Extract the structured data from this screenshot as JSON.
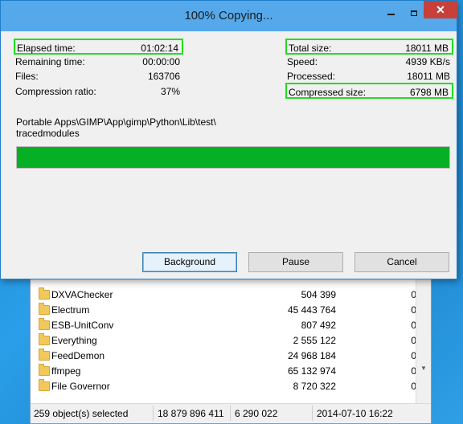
{
  "file_manager": {
    "rows": [
      {
        "name": "",
        "size": "",
        "extra": ""
      },
      {
        "name": "DXVAChecker",
        "size": "504 399",
        "extra": "0"
      },
      {
        "name": "Electrum",
        "size": "45 443 764",
        "extra": "0"
      },
      {
        "name": "ESB-UnitConv",
        "size": "807 492",
        "extra": "0"
      },
      {
        "name": "Everything",
        "size": "2 555 122",
        "extra": "0"
      },
      {
        "name": "FeedDemon",
        "size": "24 968 184",
        "extra": "0"
      },
      {
        "name": "ffmpeg",
        "size": "65 132 974",
        "extra": "0"
      },
      {
        "name": "File Governor",
        "size": "8 720 322",
        "extra": "0"
      }
    ],
    "status": {
      "selected": "259 object(s) selected",
      "total": "18 879 896 411",
      "packed": "6 290 022",
      "date": "2014-07-10 16:22"
    }
  },
  "dialog": {
    "title": "100% Copying...",
    "left_stats": [
      {
        "label": "Elapsed time:",
        "value": "01:02:14"
      },
      {
        "label": "Remaining time:",
        "value": "00:00:00"
      },
      {
        "label": "Files:",
        "value": "163706"
      },
      {
        "label": "Compression ratio:",
        "value": "37%"
      }
    ],
    "right_stats": [
      {
        "label": "Total size:",
        "value": "18011 MB"
      },
      {
        "label": "Speed:",
        "value": "4939 KB/s"
      },
      {
        "label": "Processed:",
        "value": "18011 MB"
      },
      {
        "label": "Compressed size:",
        "value": "6798 MB"
      }
    ],
    "current_path_line1": "Portable Apps\\GIMP\\App\\gimp\\Python\\Lib\\test\\",
    "current_path_line2": "tracedmodules",
    "progress_percent": 100,
    "progress_color": "#06b025",
    "buttons": {
      "background": "Background",
      "pause": "Pause",
      "cancel": "Cancel"
    },
    "close_glyph": "✕"
  }
}
